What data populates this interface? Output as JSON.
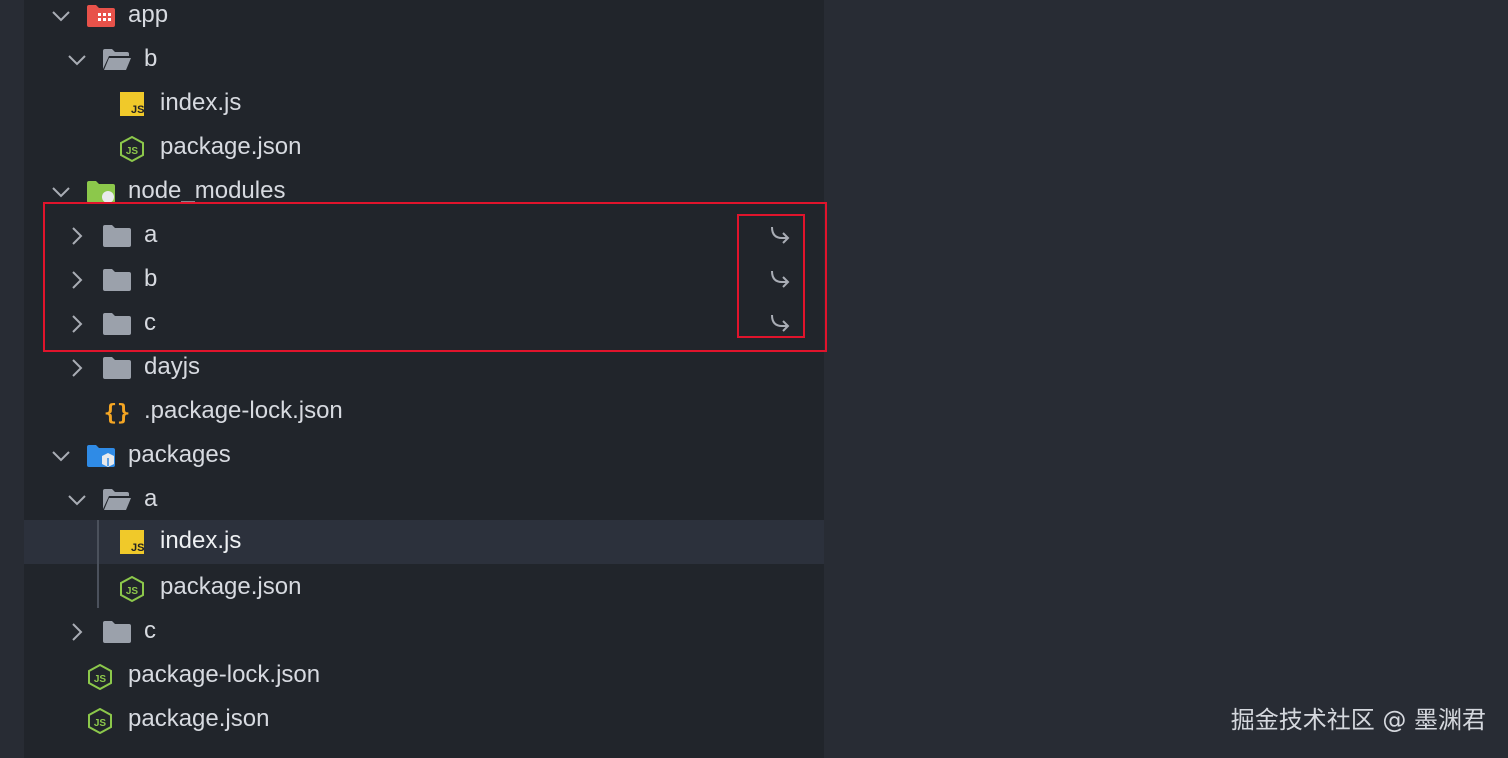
{
  "tree": {
    "items": [
      {
        "label": "app",
        "icon": "app-folder-icon",
        "expanded": true
      },
      {
        "label": "b",
        "icon": "folder-open-icon",
        "expanded": true
      },
      {
        "label": "index.js",
        "icon": "js-file-icon"
      },
      {
        "label": "package.json",
        "icon": "nodejs-file-icon"
      },
      {
        "label": "node_modules",
        "icon": "node-modules-folder-icon",
        "expanded": true
      },
      {
        "label": "a",
        "icon": "folder-icon",
        "expanded": false,
        "symlink": true
      },
      {
        "label": "b",
        "icon": "folder-icon",
        "expanded": false,
        "symlink": true
      },
      {
        "label": "c",
        "icon": "folder-icon",
        "expanded": false,
        "symlink": true
      },
      {
        "label": "dayjs",
        "icon": "folder-icon",
        "expanded": false
      },
      {
        "label": ".package-lock.json",
        "icon": "json-braces-icon"
      },
      {
        "label": "packages",
        "icon": "packages-folder-icon",
        "expanded": true
      },
      {
        "label": "a",
        "icon": "folder-open-icon",
        "expanded": true
      },
      {
        "label": "index.js",
        "icon": "js-file-icon",
        "selected": true
      },
      {
        "label": "package.json",
        "icon": "nodejs-file-icon"
      },
      {
        "label": "c",
        "icon": "folder-icon",
        "expanded": false
      },
      {
        "label": "package-lock.json",
        "icon": "nodejs-file-icon"
      },
      {
        "label": "package.json",
        "icon": "nodejs-file-icon"
      }
    ]
  },
  "watermark": "掘金技术社区 @ 墨渊君",
  "colors": {
    "editor_bg": "#282c34",
    "sidebar_bg": "#21252b",
    "selected_row": "#2c313c",
    "highlight_border": "#e0142c",
    "folder": "#9ba1ab",
    "js_yellow": "#f0c92a",
    "node_green": "#8cc84b",
    "app_red": "#e8524a",
    "packages_blue": "#2f8be6",
    "json_orange": "#f5a623"
  }
}
